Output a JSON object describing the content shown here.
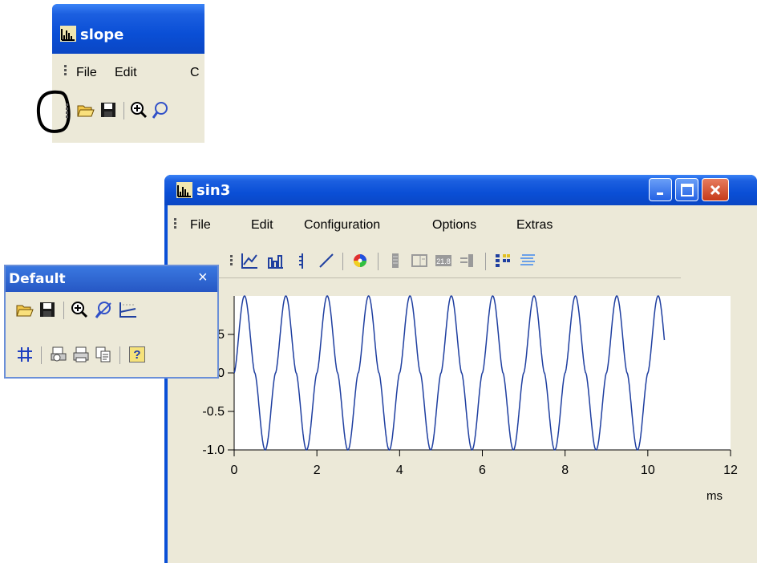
{
  "slope_window": {
    "title": "slope",
    "menu": [
      "File",
      "Edit",
      "C"
    ],
    "toolbar_icons": [
      "grip-handle-icon",
      "open-folder-icon",
      "save-icon",
      "zoom-in-icon",
      "zoom-icon"
    ]
  },
  "sin3_window": {
    "title": "sin3",
    "menu": [
      "File",
      "Edit",
      "Configuration",
      "Options",
      "Extras"
    ],
    "window_buttons": [
      "minimize-icon",
      "maximize-icon",
      "close-icon"
    ],
    "toolbar_icons": [
      "line-chart-icon",
      "bar-chart-icon",
      "y-axis-icon",
      "line-tool-icon",
      "color-wheel-icon",
      "panel-icon",
      "table-icon",
      "value-display-icon",
      "align-icon",
      "legend-icon",
      "hatch-icon"
    ]
  },
  "floating_toolbar": {
    "title": "Default",
    "close": "×",
    "row1_icons": [
      "open-folder-icon",
      "save-icon",
      "zoom-in-icon",
      "zoom-off-icon",
      "axis-scale-icon"
    ],
    "row2_icons": [
      "grid-icon",
      "print-preview-icon",
      "print-icon",
      "copy-icon",
      "help-icon"
    ],
    "help_label": "?"
  },
  "chart_data": {
    "type": "line",
    "xlabel": "ms",
    "xlim": [
      0,
      12
    ],
    "ylim": [
      -1.0,
      1.0
    ],
    "x_ticks": [
      "0",
      "2",
      "4",
      "6",
      "8",
      "10",
      "12"
    ],
    "y_ticks": [
      "-1.0",
      "-0.5",
      "0.0",
      "0.5"
    ],
    "series": [
      {
        "x_start": 0,
        "x_end": 10.4,
        "frequency_khz": 1.0,
        "formula": "|sin| shaped waveform between -1 and 1",
        "color": "#1f3fa0"
      }
    ],
    "grid": false
  }
}
